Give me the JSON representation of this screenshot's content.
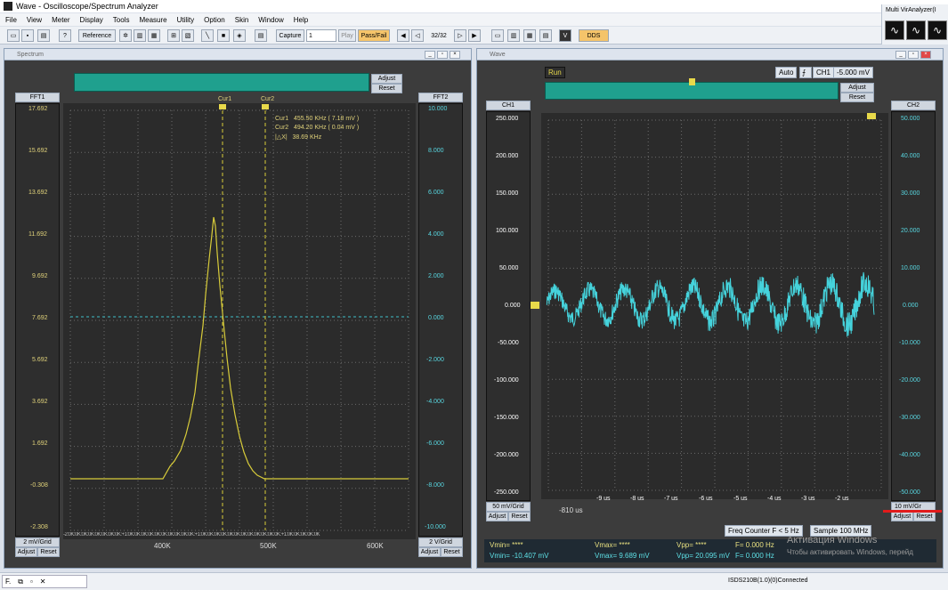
{
  "app": {
    "title": "Wave - Oscilloscope/Spectrum Analyzer"
  },
  "menu": [
    "File",
    "View",
    "Meter",
    "Display",
    "Tools",
    "Measure",
    "Utility",
    "Option",
    "Skin",
    "Window",
    "Help"
  ],
  "toolbar": {
    "reference": "Reference",
    "capture": "Capture",
    "capture_value": "1",
    "play": "Play",
    "passfail": "Pass/Fail",
    "frame": "32/32",
    "v": "V",
    "dds": "DDS"
  },
  "multivi": {
    "title": "Multi VirAnalyzer(I"
  },
  "spectrum": {
    "title": "Spectrum",
    "fft1": "FFT1",
    "fft2": "FFT2",
    "adjust": "Adjust",
    "reset": "Reset",
    "left_ticks": [
      "17.692",
      "15.692",
      "13.692",
      "11.692",
      "9.692",
      "7.692",
      "5.692",
      "3.692",
      "1.692",
      "-0.308",
      "-2.308"
    ],
    "right_ticks": [
      "10.000",
      "8.000",
      "6.000",
      "4.000",
      "2.000",
      "0.000",
      "-2.000",
      "-4.000",
      "-6.000",
      "-8.000",
      "-10.000"
    ],
    "x_ticks": [
      "400K",
      "500K",
      "600K"
    ],
    "left_scale": "2 mV/Grid",
    "right_scale": "2 V/Grid",
    "cur1_label": "Cur1",
    "cur2_label": "Cur2",
    "cursor_text": [
      "Cur1   455.50 KHz ( 7.18 mV )",
      "Cur2   494.20 KHz ( 0.04 mV )",
      "|△X|   38.69 KHz"
    ]
  },
  "wave": {
    "title": "Wave",
    "run": "Run",
    "auto": "Auto",
    "trig_ch": "CH1",
    "trig_level": "-5.000 mV",
    "ch1": "CH1",
    "ch2": "CH2",
    "adjust": "Adjust",
    "reset": "Reset",
    "left_ticks": [
      "250.000",
      "200.000",
      "150.000",
      "100.000",
      "50.000",
      "0.000",
      "-50.000",
      "-100.000",
      "-150.000",
      "-200.000",
      "-250.000"
    ],
    "right_ticks": [
      "50.000",
      "40.000",
      "30.000",
      "20.000",
      "10.000",
      "0.000",
      "-10.000",
      "-20.000",
      "-30.000",
      "-40.000",
      "-50.000"
    ],
    "x_ticks": [
      "-9 us",
      "-8 us",
      "-7 us",
      "-6 us",
      "-5 us",
      "-4 us",
      "-3 us",
      "-2 us"
    ],
    "x_start": "-810 us",
    "ch1_scale": "50 mV/Grid",
    "ch2_scale": "10 mV/Gr",
    "freq_counter": "Freq Counter F < 5 Hz",
    "sample": "Sample 100 MHz",
    "meas": {
      "vmin1": "Vmin= ****",
      "vmax1": "Vmax= ****",
      "vpp1": "Vpp= ****",
      "f1": "F= 0.000 Hz",
      "vmin2": "Vmin= -10.407 mV",
      "vmax2": "Vmax= 9.689 mV",
      "vpp2": "Vpp= 20.095 mV",
      "f2": "F= 0.000 Hz"
    }
  },
  "watermark": {
    "line1": "Активация Windows",
    "line2": "Чтобы активировать Windows, перейд"
  },
  "status": {
    "device": "ISDS210B(1.0)(0)Connected",
    "task": "F."
  },
  "colors": {
    "fft_trace": "#d8cc3a",
    "wave_trace": "#45d3dc",
    "background": "#2b2b2b",
    "accent_red": "#e21b1b"
  }
}
